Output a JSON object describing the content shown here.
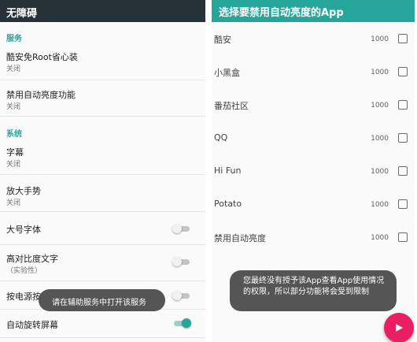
{
  "left": {
    "title": "无障碍",
    "sections": {
      "services": "服务",
      "system": "系统"
    },
    "items": [
      {
        "title": "酷安免Root省心装",
        "subtitle": "关闭"
      },
      {
        "title": "禁用自动亮度功能",
        "subtitle": "关闭"
      },
      {
        "title": "字幕",
        "subtitle": "关闭"
      },
      {
        "title": "放大手势",
        "subtitle": "关闭"
      },
      {
        "title": "大号字体",
        "toggle": false
      },
      {
        "title": "高对比度文字",
        "subtitle": "（实验性）",
        "toggle": false
      },
      {
        "title": "按电源按钮结束通话",
        "toggle": false
      },
      {
        "title": "自动旋转屏幕",
        "toggle": true
      }
    ],
    "toast": "请在辅助服务中打开该服务"
  },
  "right": {
    "title": "选择要禁用自动亮度的App",
    "apps": [
      {
        "name": "酷安",
        "count": "1000",
        "checked": false
      },
      {
        "name": "小黑盒",
        "count": "1000",
        "checked": false
      },
      {
        "name": "番茄社区",
        "count": "1000",
        "checked": false
      },
      {
        "name": "QQ",
        "count": "1000",
        "checked": false
      },
      {
        "name": "Hi Fun",
        "count": "1000",
        "checked": false
      },
      {
        "name": "Potato",
        "count": "1000",
        "checked": false
      },
      {
        "name": "禁用自动亮度",
        "count": "1000",
        "checked": false
      }
    ],
    "toast": "您最终没有授予该App查看App使用情况的权限，所以部分功能将会受到限制",
    "fab_icon": "play-icon"
  },
  "colors": {
    "accent": "#26a69a",
    "dark_appbar": "#263238",
    "fab": "#e91e63",
    "toast": "#555555"
  }
}
